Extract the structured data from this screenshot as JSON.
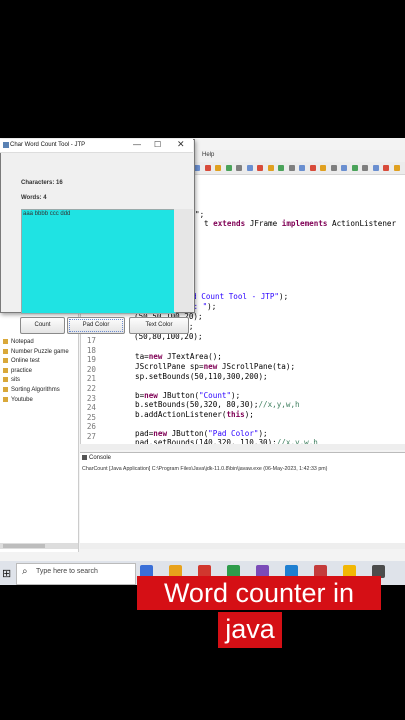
{
  "eclipse": {
    "menu_help": "Help",
    "line_numbers": [
      "17",
      "18",
      "19",
      "20",
      "21",
      "22",
      "23",
      "24",
      "25",
      "26",
      "27"
    ],
    "code": [
      {
        "kind": "plain",
        "text": "\";"
      },
      {
        "kind": "mixed",
        "parts": [
          {
            "t": "t ",
            "c": "plain"
          },
          {
            "t": "extends",
            "c": "kw"
          },
          {
            "t": " JFrame ",
            "c": "plain"
          },
          {
            "t": "implements",
            "c": "kw"
          },
          {
            "t": " ActionListener",
            "c": "plain"
          }
        ]
      },
      {
        "kind": "mixed",
        "parts": [
          {
            "t": "ord Count Tool - JTP\"",
            "c": "str"
          },
          {
            "t": ");",
            "c": "plain"
          }
        ]
      },
      {
        "kind": "mixed",
        "parts": [
          {
            "t": "l(",
            "c": "plain"
          },
          {
            "t": "\"Characters: \"",
            "c": "str"
          },
          {
            "t": ");",
            "c": "plain"
          }
        ]
      },
      {
        "kind": "plain",
        "text": "(50,50,100,20);"
      },
      {
        "kind": "mixed",
        "parts": [
          {
            "t": "l(",
            "c": "plain"
          },
          {
            "t": "\"Words: \"",
            "c": "str"
          },
          {
            "t": ");",
            "c": "plain"
          }
        ]
      },
      {
        "kind": "plain",
        "text": "(50,80,100,20);"
      },
      {
        "kind": "mixed",
        "parts": [
          {
            "t": "ta=",
            "c": "plain"
          },
          {
            "t": "new",
            "c": "kw"
          },
          {
            "t": " JTextArea();",
            "c": "plain"
          }
        ]
      },
      {
        "kind": "mixed",
        "parts": [
          {
            "t": "JScrollPane sp=",
            "c": "plain"
          },
          {
            "t": "new",
            "c": "kw"
          },
          {
            "t": " JScrollPane(ta);",
            "c": "plain"
          }
        ]
      },
      {
        "kind": "plain",
        "text": "sp.setBounds(50,110,300,200);"
      },
      {
        "kind": "mixed",
        "parts": [
          {
            "t": "b=",
            "c": "plain"
          },
          {
            "t": "new",
            "c": "kw"
          },
          {
            "t": " JButton(",
            "c": "plain"
          },
          {
            "t": "\"Count\"",
            "c": "str"
          },
          {
            "t": ");",
            "c": "plain"
          }
        ]
      },
      {
        "kind": "mixed",
        "parts": [
          {
            "t": "b.setBounds(50,320, 80,30);",
            "c": "plain"
          },
          {
            "t": "//x,y,w,h",
            "c": "cm"
          }
        ]
      },
      {
        "kind": "mixed",
        "parts": [
          {
            "t": "b.addActionListener(",
            "c": "plain"
          },
          {
            "t": "this",
            "c": "kw"
          },
          {
            "t": ");",
            "c": "plain"
          }
        ]
      },
      {
        "kind": "mixed",
        "parts": [
          {
            "t": "pad=",
            "c": "plain"
          },
          {
            "t": "new",
            "c": "kw"
          },
          {
            "t": " JButton(",
            "c": "plain"
          },
          {
            "t": "\"Pad Color\"",
            "c": "str"
          },
          {
            "t": ");",
            "c": "plain"
          }
        ]
      },
      {
        "kind": "mixed",
        "parts": [
          {
            "t": "pad.setBounds(140,320, 110,30);",
            "c": "plain"
          },
          {
            "t": "//x,y,w,h",
            "c": "cm"
          }
        ]
      }
    ],
    "package_items": [
      "Notepad",
      "Number Puzzle game",
      "Online test",
      "practice",
      "sits",
      "Sorting Algorithms",
      "Youtube"
    ],
    "console_tab": "Console",
    "console_line": "CharCount [Java Application] C:\\Program Files\\Java\\jdk-11.0.8\\bin\\javaw.exe  (06-May-2023, 1:42:33 pm)"
  },
  "taskbar": {
    "search_placeholder": "Type here to search",
    "app_colors": [
      "#3a6fd8",
      "#e8a21c",
      "#d1372e",
      "#2e9b4b",
      "#7b4bb8",
      "#1f7fd1",
      "#c43b3b",
      "#f2b705",
      "#4c4c4c"
    ]
  },
  "java_window": {
    "title": "Char Word Count Tool - JTP",
    "characters_label": "Characters: 16",
    "words_label": "Words: 4",
    "text_content": "aaa bbbb ccc ddd",
    "text_area_color": "#1fe3e3",
    "buttons": {
      "count": "Count",
      "pad_color": "Pad Color",
      "text_color": "Text Color"
    }
  },
  "caption": {
    "line1": "Word counter in",
    "line2": "java",
    "background": "#d50f15"
  }
}
